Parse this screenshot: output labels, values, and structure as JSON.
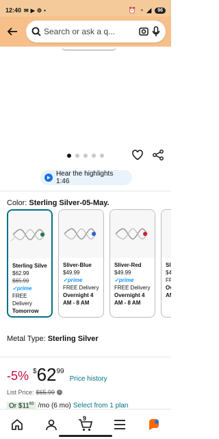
{
  "status": {
    "time": "12:40",
    "battery": "96"
  },
  "search": {
    "placeholder": "Search or ask a q..."
  },
  "carousel": {
    "dot_count": 5,
    "active_index": 0
  },
  "highlights": {
    "label": "Hear the highlights 1:46"
  },
  "color": {
    "label": "Color: ",
    "value": "Sterling Silver-05-May."
  },
  "variants": [
    {
      "name": "Sterling Silve...",
      "price": "$62.99",
      "list_price": "$65.99",
      "prime": "prime",
      "delivery_1": "FREE Delivery",
      "delivery_2": "Tomorrow",
      "gem_color": "#1e7b4d",
      "selected": true
    },
    {
      "name": "Sliver-Blue",
      "price": "$49.99",
      "prime": "prime",
      "delivery_1": "FREE Delivery",
      "delivery_2": "Overnight 4",
      "delivery_3": "AM - 8 AM",
      "gem_color": "#2d5fd0",
      "selected": false
    },
    {
      "name": "Sliver-Red",
      "price": "$49.99",
      "prime": "prime",
      "delivery_1": "FREE Delivery",
      "delivery_2": "Overnight 4",
      "delivery_3": "AM - 8 AM",
      "gem_color": "#d0202a",
      "selected": false
    },
    {
      "name": "Sli",
      "price": "$4",
      "delivery_1": "FR",
      "delivery_2": "Ov",
      "delivery_3": "AM",
      "selected": false
    }
  ],
  "metal": {
    "label": "Metal Type: ",
    "value": "Sterling Silver"
  },
  "price": {
    "discount": "-5%",
    "currency": "$",
    "whole": "62",
    "fraction": "99",
    "history_link": "Price history",
    "list_label": "List Price:",
    "list_value": "$65.99"
  },
  "plan": {
    "prefix": "Or $11",
    "cents": "63",
    "suffix": "/mo (6 mo)",
    "link": "Select from 1 plan"
  },
  "nav": {
    "cart_count": "9"
  },
  "colors": {
    "header": "#f7c08b",
    "link": "#007185",
    "discount": "#cc0c39",
    "selected_border": "#007185"
  }
}
